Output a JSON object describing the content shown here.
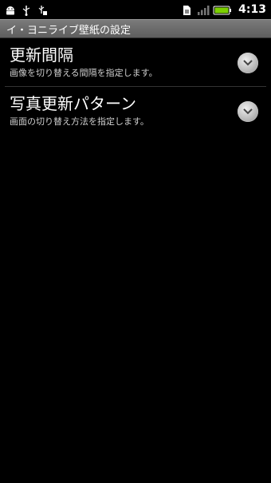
{
  "status_bar": {
    "time": "4:13",
    "left_icons": [
      "android-icon",
      "usb-icon",
      "usb-debug-icon"
    ],
    "right_icons": [
      "sim-card-icon",
      "signal-icon",
      "battery-icon"
    ]
  },
  "header": {
    "title": "イ・ヨニライブ壁紙の設定"
  },
  "preferences": [
    {
      "title": "更新間隔",
      "summary": "画像を切り替える間隔を指定します。"
    },
    {
      "title": "写真更新パターン",
      "summary": "画面の切り替え方法を指定します。"
    }
  ],
  "colors": {
    "background": "#000000",
    "titlebar": "#6b6b6b",
    "summary_text": "#cfcfcf",
    "battery": "#7cd000"
  }
}
